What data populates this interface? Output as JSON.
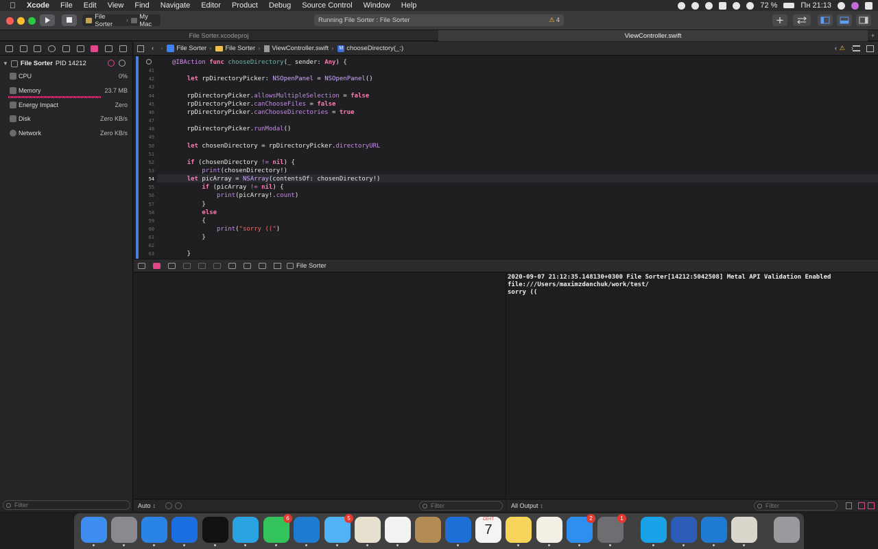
{
  "menubar": {
    "items": [
      "Xcode",
      "File",
      "Edit",
      "View",
      "Find",
      "Navigate",
      "Editor",
      "Product",
      "Debug",
      "Source Control",
      "Window",
      "Help"
    ],
    "battery": "72 %",
    "clock": "Пн 21:13"
  },
  "toolbar": {
    "scheme_name": "File Sorter",
    "destination": "My Mac",
    "activity_text": "Running File Sorter : File Sorter",
    "warning_count": "4"
  },
  "tabs": [
    {
      "label": "File Sorter.xcodeproj",
      "active": false
    },
    {
      "label": "ViewController.swift",
      "active": true
    }
  ],
  "navigator": {
    "process_name": "File Sorter",
    "process_pid": "PID 14212",
    "gauges": [
      {
        "label": "CPU",
        "value": "0%"
      },
      {
        "label": "Memory",
        "value": "23.7 MB"
      },
      {
        "label": "Energy Impact",
        "value": "Zero"
      },
      {
        "label": "Disk",
        "value": "Zero KB/s"
      },
      {
        "label": "Network",
        "value": "Zero KB/s"
      }
    ],
    "filter_placeholder": "Filter"
  },
  "jumpbar": {
    "crumbs": [
      "File Sorter",
      "File Sorter",
      "ViewController.swift",
      "chooseDirectory(_:)"
    ]
  },
  "editor": {
    "current_line": "54",
    "lines": [
      {
        "n": "40",
        "code": ""
      },
      {
        "n": "41",
        "code": ""
      },
      {
        "n": "42",
        "code": ""
      },
      {
        "n": "43",
        "code": ""
      },
      {
        "n": "44",
        "code": ""
      },
      {
        "n": "45",
        "code": ""
      },
      {
        "n": "46",
        "code": ""
      },
      {
        "n": "47",
        "code": ""
      },
      {
        "n": "48",
        "code": ""
      },
      {
        "n": "49",
        "code": ""
      },
      {
        "n": "50",
        "code": ""
      },
      {
        "n": "51",
        "code": ""
      },
      {
        "n": "52",
        "code": ""
      },
      {
        "n": "53",
        "code": ""
      },
      {
        "n": "54",
        "code": ""
      },
      {
        "n": "55",
        "code": ""
      },
      {
        "n": "56",
        "code": ""
      },
      {
        "n": "57",
        "code": ""
      },
      {
        "n": "58",
        "code": ""
      },
      {
        "n": "59",
        "code": ""
      },
      {
        "n": "60",
        "code": ""
      },
      {
        "n": "61",
        "code": ""
      },
      {
        "n": "62",
        "code": ""
      },
      {
        "n": "63",
        "code": ""
      }
    ]
  },
  "debugbar": {
    "target_label": "File Sorter"
  },
  "variables": {
    "scope_label": "Auto",
    "filter_placeholder": "Filter"
  },
  "console": {
    "lines": [
      "2020-09-07 21:12:35.148130+0300 File Sorter[14212:5042508] Metal API Validation Enabled",
      "file:///Users/maximzdanchuk/work/test/",
      "sorry (("
    ],
    "output_label": "All Output",
    "filter_placeholder": "Filter"
  },
  "dock": {
    "apps": [
      {
        "name": "finder-icon",
        "color": "#3d8ef0",
        "badge": ""
      },
      {
        "name": "launchpad-icon",
        "color": "#8a8a8e",
        "badge": ""
      },
      {
        "name": "safari-icon",
        "color": "#2a84e8",
        "badge": ""
      },
      {
        "name": "xcode-icon",
        "color": "#1c6fe0",
        "badge": ""
      },
      {
        "name": "terminal-icon",
        "color": "#111111",
        "badge": ""
      },
      {
        "name": "telegram-icon",
        "color": "#2aa3e0",
        "badge": ""
      },
      {
        "name": "facetime-icon",
        "color": "#33c35b",
        "badge": "6"
      },
      {
        "name": "vscode-icon",
        "color": "#1f7ad1",
        "badge": ""
      },
      {
        "name": "messages-icon",
        "color": "#4fb3f5",
        "badge": "5"
      },
      {
        "name": "maps-icon",
        "color": "#e6e1cf",
        "badge": ""
      },
      {
        "name": "photos-icon",
        "color": "#f2f2f2",
        "badge": ""
      },
      {
        "name": "contacts-icon",
        "color": "#b48a55",
        "badge": ""
      },
      {
        "name": "teamviewer-icon",
        "color": "#1e6ed8",
        "badge": ""
      },
      {
        "name": "calendar-icon",
        "color": "#f4f4f4",
        "badge": ""
      },
      {
        "name": "notes-icon",
        "color": "#f7d55a",
        "badge": ""
      },
      {
        "name": "textedit-icon",
        "color": "#f3efe4",
        "badge": ""
      },
      {
        "name": "appstore-icon",
        "color": "#2f8ff0",
        "badge": "2"
      },
      {
        "name": "system-preferences-icon",
        "color": "#6e6e72",
        "badge": "1"
      },
      {
        "name": "skype-icon",
        "color": "#1aa2e8",
        "badge": ""
      },
      {
        "name": "word-icon",
        "color": "#2b5db6",
        "badge": ""
      },
      {
        "name": "vscode-icon-2",
        "color": "#1f7ad1",
        "badge": ""
      },
      {
        "name": "preview-icon",
        "color": "#d9d6cc",
        "badge": ""
      },
      {
        "name": "trash-icon",
        "color": "#9a9a9e",
        "badge": ""
      }
    ],
    "calendar_month": "СЕНТ",
    "calendar_day": "7"
  }
}
